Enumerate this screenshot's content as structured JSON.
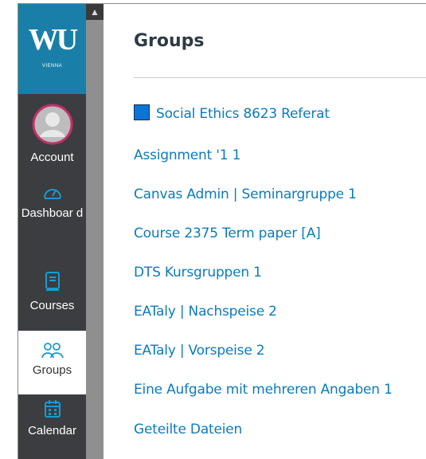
{
  "brand": {
    "logo_text": "WU",
    "logo_sub": "VIENNA"
  },
  "nav": {
    "account": "Account",
    "dashboard": "Dashboar d",
    "courses": "Courses",
    "groups": "Groups",
    "calendar": "Calendar"
  },
  "page": {
    "title": "Groups"
  },
  "groups": [
    "Social Ethics 8623 Referat",
    "Assignment '1 1",
    "Canvas Admin | Seminargruppe 1",
    "Course 2375 Term paper [A]",
    "DTS Kursgruppen 1",
    "EATaly | Nachspeise 2",
    "EATaly | Vorspeise 2",
    "Eine Aufgabe mit mehreren Angaben 1",
    "Geteilte Dateien"
  ],
  "colors": {
    "sidebar": "#3b3d40",
    "logo_bg": "#1a7fa8",
    "link": "#0b7bbd",
    "swatch": "#0b74d6"
  },
  "icons": {
    "dashboard": "speedometer-icon",
    "courses": "book-icon",
    "groups": "people-icon",
    "calendar": "calendar-icon"
  }
}
